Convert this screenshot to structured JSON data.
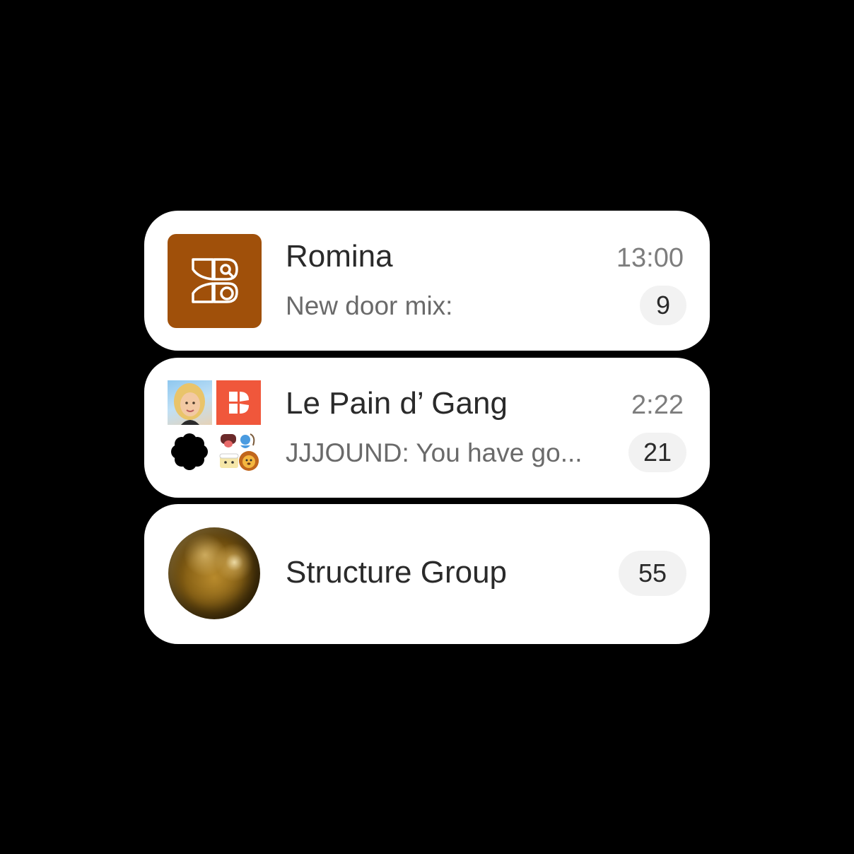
{
  "colors": {
    "background": "#000000",
    "card": "#ffffff",
    "romina_avatar": "#a0500a",
    "badge_bg": "#f2f2f2",
    "orange_tile": "#f0573b"
  },
  "chats": [
    {
      "title": "Romina",
      "time": "13:00",
      "preview": "New door mix:",
      "unread": "9",
      "avatar_icon": "romina-logo-icon"
    },
    {
      "title": "Le Pain d’ Gang",
      "time": "2:22",
      "preview": "JJJOUND: You have go...",
      "unread": "21",
      "avatar_icon": "group-collage-icon"
    },
    {
      "title": "Structure Group",
      "unread": "55",
      "avatar_icon": "gold-sphere-icon"
    }
  ]
}
